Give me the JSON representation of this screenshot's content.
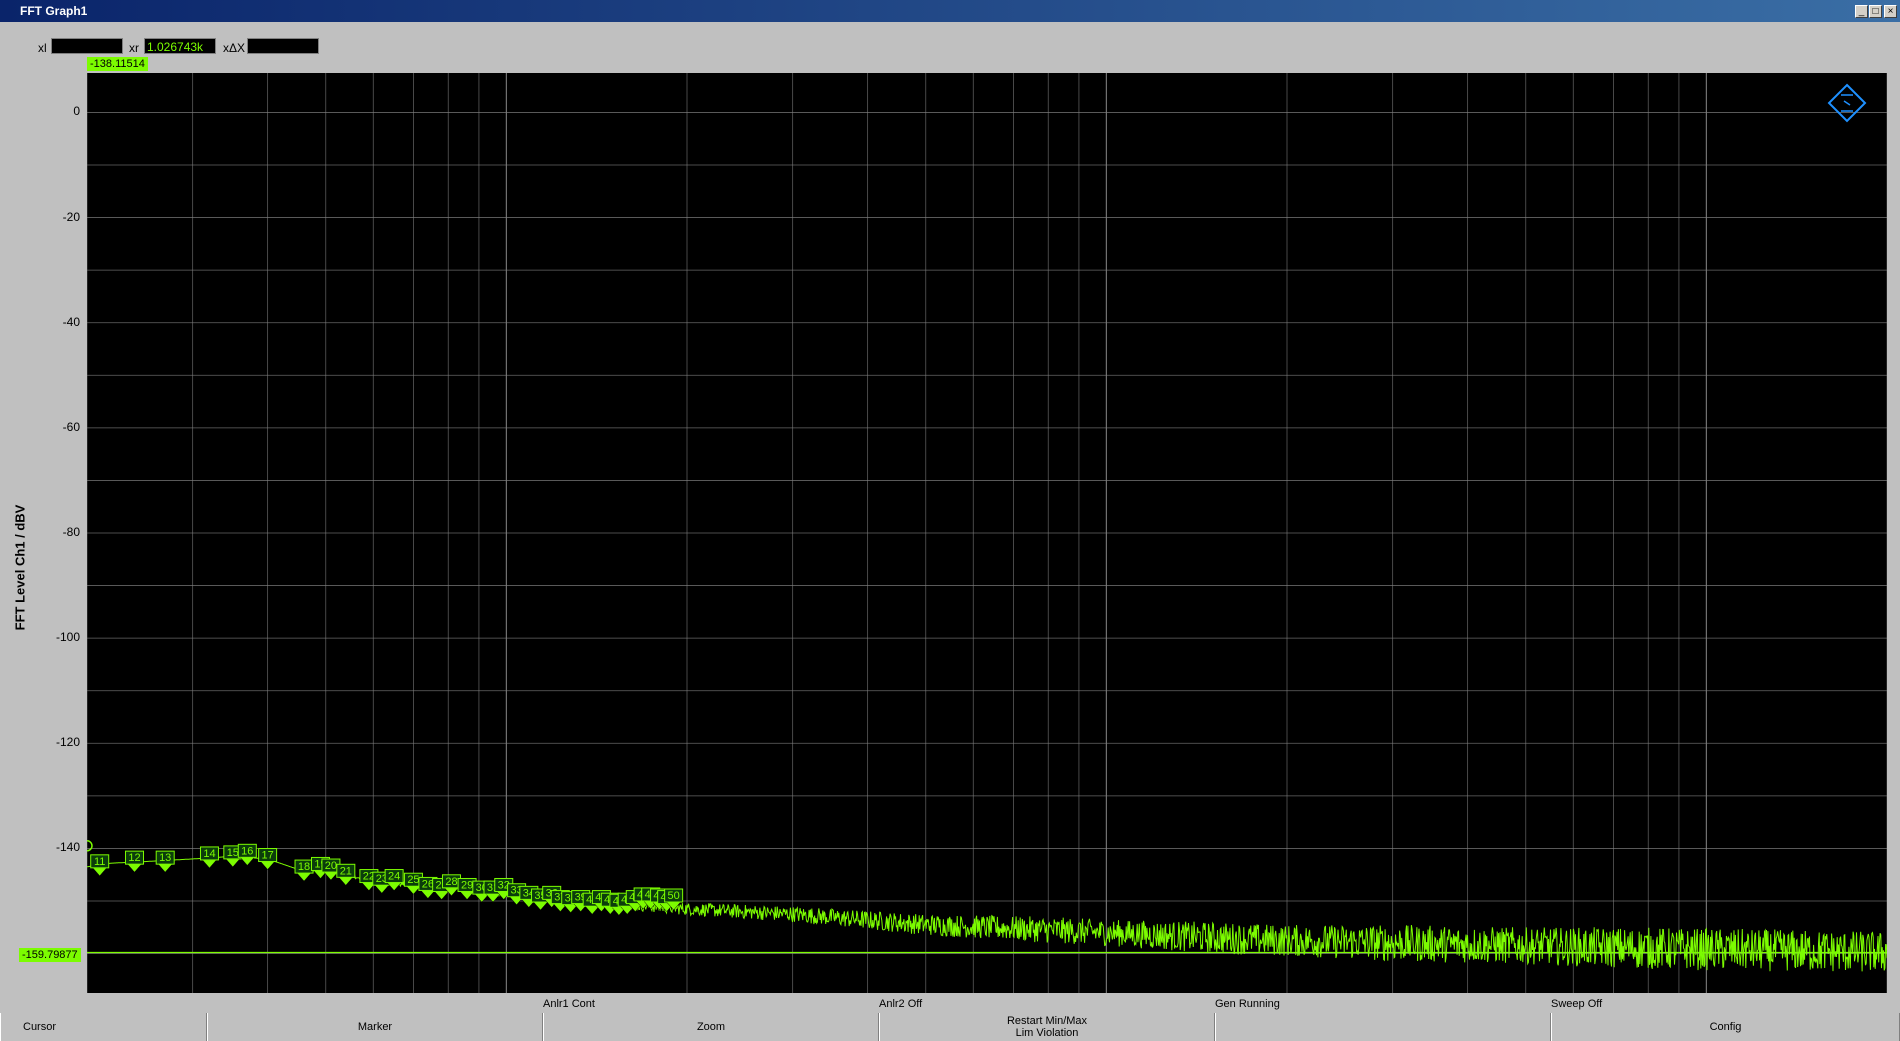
{
  "window": {
    "title": "FFT Graph1",
    "buttons": [
      "_",
      "□",
      "×"
    ]
  },
  "readouts": {
    "xl_label": "xl",
    "xl_value": "",
    "xr_label": "xr",
    "xr_value": "1.026743k",
    "xdx_label": "xΔX",
    "xdx_value": "",
    "top_cursor_value": "-138.11514",
    "bottom_cursor_value": "-159.79877"
  },
  "status": {
    "anlr1": "Anlr1 Cont",
    "anlr2": "Anlr2 Off",
    "gen": "Gen Running",
    "sweep": "Sweep Off"
  },
  "softkeys": {
    "cursor": "Cursor",
    "marker": "Marker",
    "zoom": "Zoom",
    "restart_line1": "Restart Min/Max",
    "restart_line2": "Lim Violation",
    "empty": "",
    "config": "Config"
  },
  "colors": {
    "plot_bg": "#000000",
    "trace": "#7cfc00",
    "grid": "#808080",
    "logo": "#1e90ff"
  },
  "icons": {
    "logo": "rohde-schwarz-logo-icon"
  },
  "chart_data": {
    "type": "line",
    "title": "",
    "xlabel": "",
    "ylabel": "FFT Level Ch1 / dBV",
    "xscale": "log",
    "xlim": [
      20,
      20000
    ],
    "ylim": [
      -167.5,
      7.5
    ],
    "yticks": [
      0,
      -20,
      -40,
      -60,
      -80,
      -100,
      -120,
      -140
    ],
    "grid": true,
    "cursors": {
      "upper": -138.11514,
      "lower": -159.79877
    },
    "markers": [
      {
        "label": "11",
        "x": 21,
        "y": -143.5
      },
      {
        "label": "12",
        "x": 24,
        "y": -142.8
      },
      {
        "label": "13",
        "x": 27,
        "y": -142.8
      },
      {
        "label": "14",
        "x": 32,
        "y": -142.0
      },
      {
        "label": "15",
        "x": 35,
        "y": -141.8
      },
      {
        "label": "16",
        "x": 37,
        "y": -141.5
      },
      {
        "label": "17",
        "x": 40,
        "y": -142.3
      },
      {
        "label": "18",
        "x": 46,
        "y": -144.5
      },
      {
        "label": "19",
        "x": 49,
        "y": -144.0
      },
      {
        "label": "20",
        "x": 51,
        "y": -144.3
      },
      {
        "label": "21",
        "x": 54,
        "y": -145.3
      },
      {
        "label": "22",
        "x": 59,
        "y": -146.3
      },
      {
        "label": "23",
        "x": 62,
        "y": -146.8
      },
      {
        "label": "24",
        "x": 65,
        "y": -146.3
      },
      {
        "label": "25",
        "x": 70,
        "y": -147.0
      },
      {
        "label": "26",
        "x": 74,
        "y": -147.8
      },
      {
        "label": "27",
        "x": 78,
        "y": -148.0
      },
      {
        "label": "28",
        "x": 81,
        "y": -147.3
      },
      {
        "label": "29",
        "x": 86,
        "y": -148.0
      },
      {
        "label": "30",
        "x": 91,
        "y": -148.5
      },
      {
        "label": "31",
        "x": 95,
        "y": -148.5
      },
      {
        "label": "32",
        "x": 99,
        "y": -148.0
      },
      {
        "label": "33",
        "x": 104,
        "y": -149.0
      },
      {
        "label": "34",
        "x": 109,
        "y": -149.5
      },
      {
        "label": "35",
        "x": 114,
        "y": -150.0
      },
      {
        "label": "36",
        "x": 119,
        "y": -149.5
      },
      {
        "label": "37",
        "x": 123,
        "y": -150.3
      },
      {
        "label": "38",
        "x": 128,
        "y": -150.5
      },
      {
        "label": "39",
        "x": 133,
        "y": -150.3
      },
      {
        "label": "40",
        "x": 139,
        "y": -150.8
      },
      {
        "label": "41",
        "x": 144,
        "y": -150.3
      },
      {
        "label": "42",
        "x": 149,
        "y": -150.8
      },
      {
        "label": "43",
        "x": 154,
        "y": -151.0
      },
      {
        "label": "44",
        "x": 159,
        "y": -150.8
      },
      {
        "label": "45",
        "x": 164,
        "y": -150.3
      },
      {
        "label": "46",
        "x": 169,
        "y": -149.8
      },
      {
        "label": "47",
        "x": 174,
        "y": -149.8
      },
      {
        "label": "48",
        "x": 180,
        "y": -150.0
      },
      {
        "label": "49",
        "x": 185,
        "y": -150.3
      },
      {
        "label": "50",
        "x": 190,
        "y": -150.0
      }
    ],
    "series": [
      {
        "x": [
          20,
          22,
          25,
          30,
          35,
          40,
          45,
          50,
          60,
          70,
          80,
          100,
          120,
          150,
          200,
          300,
          500,
          800,
          1000,
          1500,
          2000,
          3000,
          5000,
          8000,
          10000,
          15000,
          20000
        ],
        "y": [
          -143.5,
          -142.8,
          -142.5,
          -142.0,
          -141.5,
          -142.0,
          -144.0,
          -144.5,
          -146.0,
          -147.0,
          -147.5,
          -148.5,
          -149.5,
          -150.5,
          -151.5,
          -152.5,
          -154.5,
          -155.5,
          -156.0,
          -157.0,
          -157.5,
          -158.0,
          -158.5,
          -159.0,
          -159.2,
          -159.5,
          -159.8
        ],
        "noise": [
          0,
          0,
          0,
          0,
          0,
          0,
          0,
          0,
          0.5,
          0.5,
          0.5,
          0.8,
          1.0,
          1.0,
          1.2,
          1.5,
          2.0,
          2.5,
          2.5,
          3.0,
          3.0,
          3.5,
          3.5,
          4.0,
          4.0,
          4.0,
          4.0
        ]
      }
    ]
  }
}
